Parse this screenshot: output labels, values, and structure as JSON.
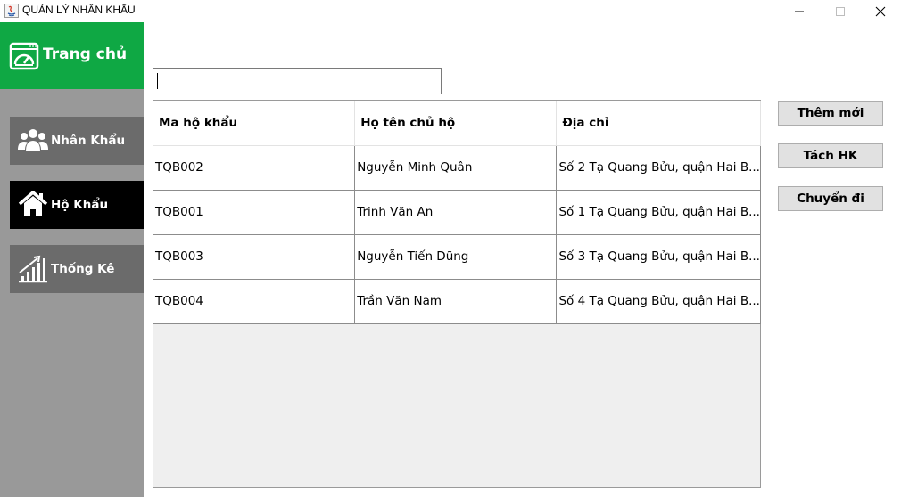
{
  "window": {
    "title": "QUẢN LÝ NHÂN KHẨU"
  },
  "sidebar": {
    "home_label": "Trang chủ",
    "items": [
      {
        "label": "Nhân Khẩu",
        "icon": "people-icon",
        "active": false
      },
      {
        "label": "Hộ Khẩu",
        "icon": "house-icon",
        "active": true
      },
      {
        "label": "Thống Kê",
        "icon": "bar-chart-icon",
        "active": false
      }
    ]
  },
  "search": {
    "value": ""
  },
  "table": {
    "columns": [
      "Mã hộ khẩu",
      "Họ tên chủ hộ",
      "Địa chỉ"
    ],
    "rows": [
      [
        "TQB002",
        "Nguyễn Minh Quân",
        "Số 2 Tạ Quang Bửu, quận Hai B..."
      ],
      [
        "TQB001",
        "Trinh Văn An",
        "Số 1 Tạ Quang Bửu, quận Hai B..."
      ],
      [
        "TQB003",
        "Nguyễn Tiến Dũng",
        "Số 3 Tạ Quang Bửu, quận Hai B..."
      ],
      [
        "TQB004",
        "Trần Văn Nam",
        "Số 4 Tạ Quang Bửu, quận Hai B..."
      ]
    ]
  },
  "actions": {
    "add_label": "Thêm mới",
    "split_label": "Tách HK",
    "move_label": "Chuyển đi"
  },
  "colors": {
    "home_green": "#0fa844",
    "sidebar_gray": "#999999",
    "nav_gray": "#6b6b6b",
    "nav_active": "#000000"
  }
}
